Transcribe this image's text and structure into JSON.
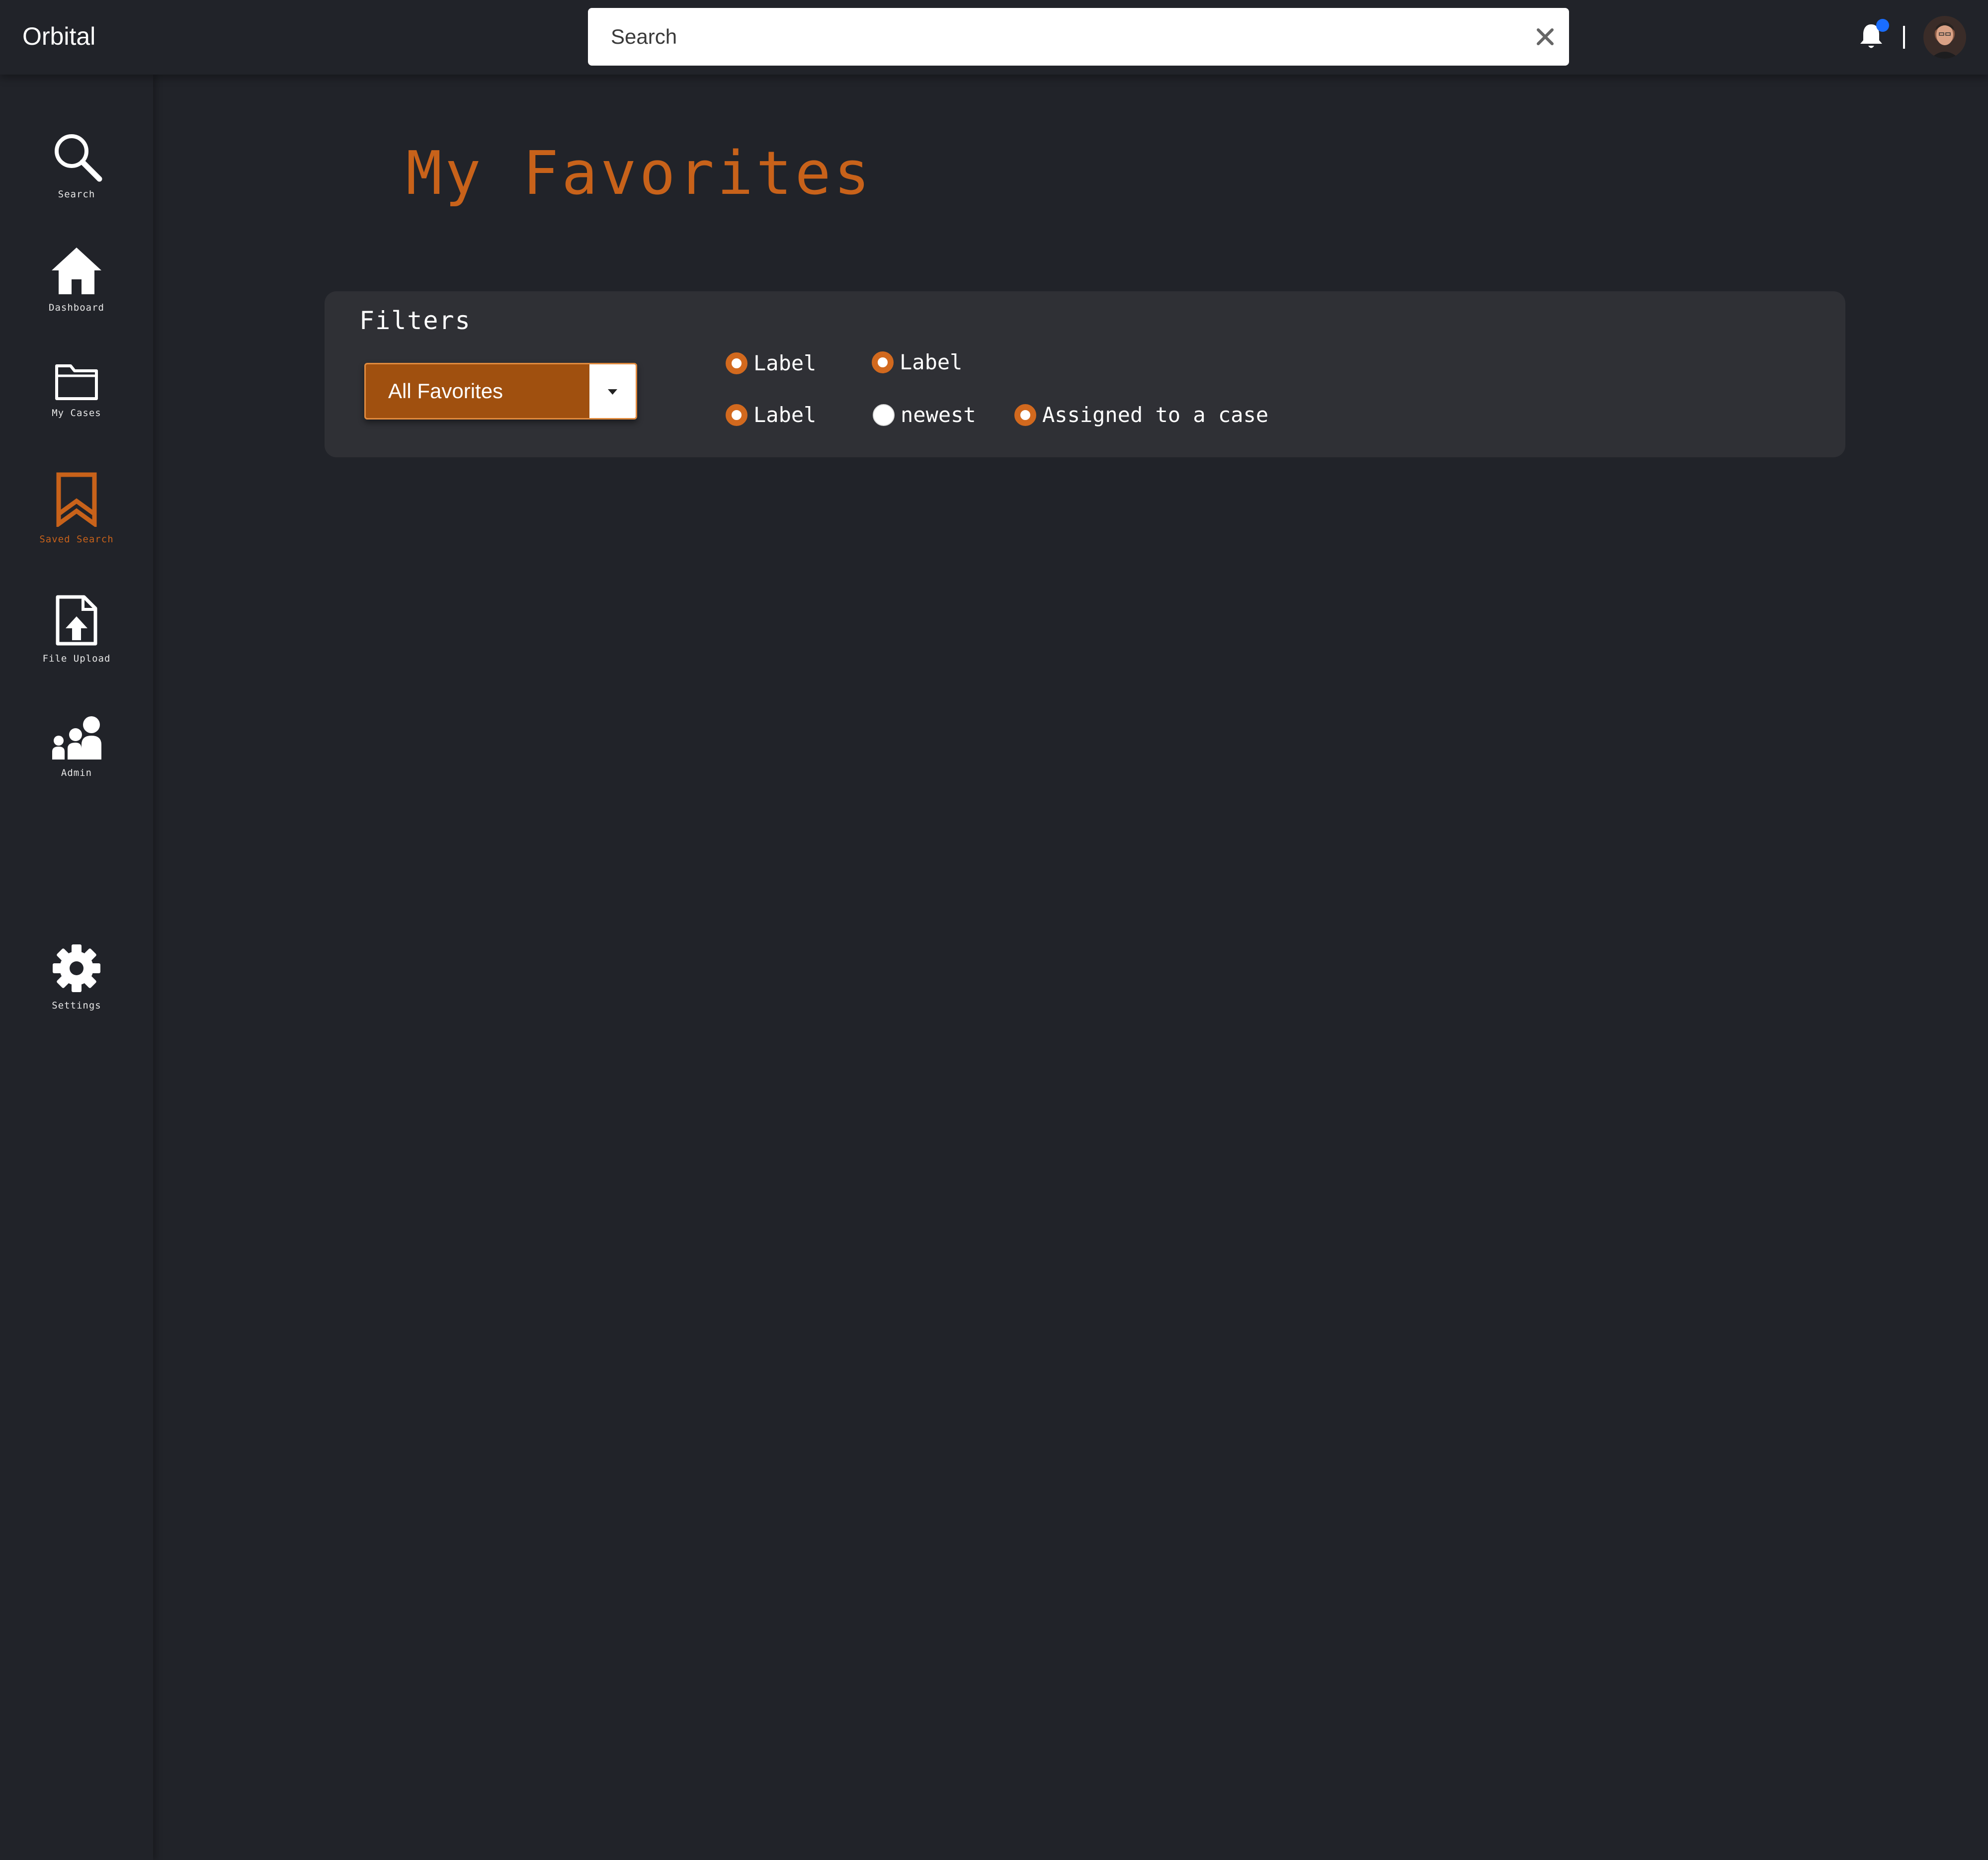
{
  "header": {
    "app_title": "Orbital",
    "search_placeholder": "Search",
    "notification_dot_color": "#1a6dff"
  },
  "sidebar": {
    "items": [
      {
        "label": "Search",
        "icon": "search-icon"
      },
      {
        "label": "Dashboard",
        "icon": "home-icon"
      },
      {
        "label": "My Cases",
        "icon": "folder-icon"
      },
      {
        "label": "Saved Search",
        "icon": "bookmark-icon",
        "active": true
      },
      {
        "label": "File Upload",
        "icon": "file-upload-icon"
      },
      {
        "label": "Admin",
        "icon": "users-icon"
      },
      {
        "label": "Settings",
        "icon": "gear-icon"
      }
    ]
  },
  "main": {
    "page_title": "My Favorites",
    "filters": {
      "title": "Filters",
      "dropdown_value": "All Favorites",
      "options": [
        {
          "label": "Label",
          "selected": true
        },
        {
          "label": "Label",
          "selected": true
        },
        {
          "label": "Label",
          "selected": true
        },
        {
          "label": "newest",
          "selected": false
        },
        {
          "label": "Assigned to a case",
          "selected": true
        }
      ]
    }
  },
  "colors": {
    "accent": "#c8621a",
    "background": "#212329",
    "panel": "#2f3035"
  }
}
